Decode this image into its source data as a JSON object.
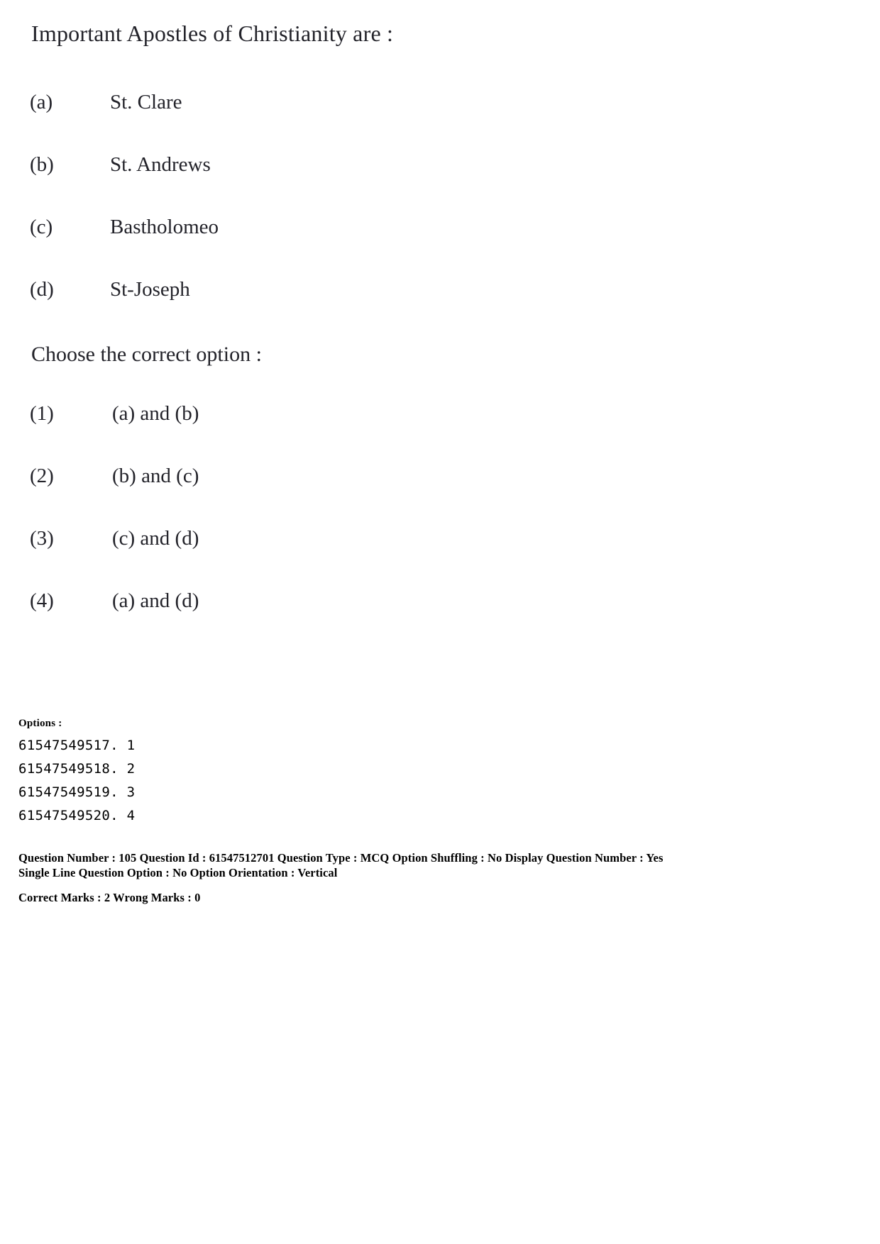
{
  "question": {
    "stem": "Important Apostles of Christianity are :",
    "instruction": "Choose the correct option :",
    "statements": [
      {
        "label": "(a)",
        "text": "St. Clare"
      },
      {
        "label": "(b)",
        "text": "St. Andrews"
      },
      {
        "label": "(c)",
        "text": "Bastholomeo"
      },
      {
        "label": "(d)",
        "text": "St-Joseph"
      }
    ],
    "answers": [
      {
        "label": "(1)",
        "text": "(a) and (b)"
      },
      {
        "label": "(2)",
        "text": "(b) and (c)"
      },
      {
        "label": "(3)",
        "text": "(c) and (d)"
      },
      {
        "label": "(4)",
        "text": "(a) and (d)"
      }
    ]
  },
  "options_block": {
    "heading": "Options :",
    "rows": [
      "61547549517. 1",
      "61547549518. 2",
      "61547549519. 3",
      "61547549520. 4"
    ]
  },
  "metadata": {
    "line1": "Question Number : 105  Question Id : 61547512701  Question Type : MCQ  Option Shuffling : No  Display Question Number : Yes",
    "line2": "Single Line Question Option : No  Option Orientation : Vertical",
    "line3": "Correct Marks : 2  Wrong Marks : 0"
  }
}
